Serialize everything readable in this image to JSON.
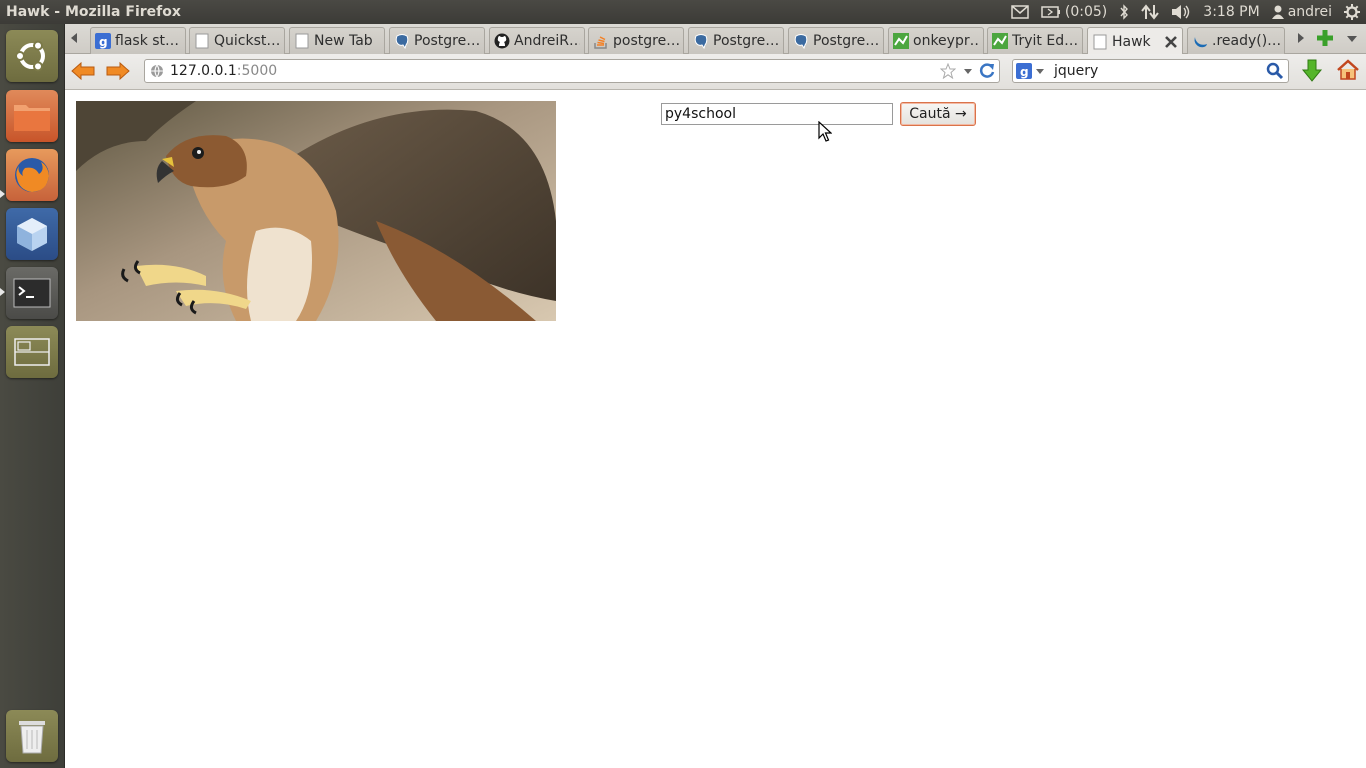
{
  "window": {
    "title": "Hawk - Mozilla Firefox"
  },
  "system_tray": {
    "battery": "(0:05)",
    "clock": "3:18 PM",
    "user": "andrei"
  },
  "tabs": [
    {
      "label": "flask st…",
      "icon": "google-icon"
    },
    {
      "label": "Quickst…",
      "icon": "page-icon"
    },
    {
      "label": "New Tab",
      "icon": "page-icon"
    },
    {
      "label": "Postgre…",
      "icon": "postgres-elephant-icon"
    },
    {
      "label": "AndreiR…",
      "icon": "github-icon"
    },
    {
      "label": "postgre…",
      "icon": "stackoverflow-icon"
    },
    {
      "label": "Postgre…",
      "icon": "postgres-elephant-icon"
    },
    {
      "label": "Postgre…",
      "icon": "postgres-elephant-icon"
    },
    {
      "label": "onkeypr…",
      "icon": "chart-icon"
    },
    {
      "label": "Tryit Ed…",
      "icon": "chart-icon"
    },
    {
      "label": "Hawk",
      "icon": "page-icon",
      "active": true
    },
    {
      "label": ".ready()…",
      "icon": "jquery-icon"
    }
  ],
  "navbar": {
    "url_host": "127.0.0.1",
    "url_port": ":5000",
    "search_value": "jquery"
  },
  "page": {
    "search_value": "py4school",
    "submit_label": "Caută →",
    "image_subject": "red-tailed hawk photograph"
  },
  "colors": {
    "accent_orange": "#e0793b",
    "launcher_bg": "#42423c",
    "topbar_bg": "#3c3b37"
  }
}
